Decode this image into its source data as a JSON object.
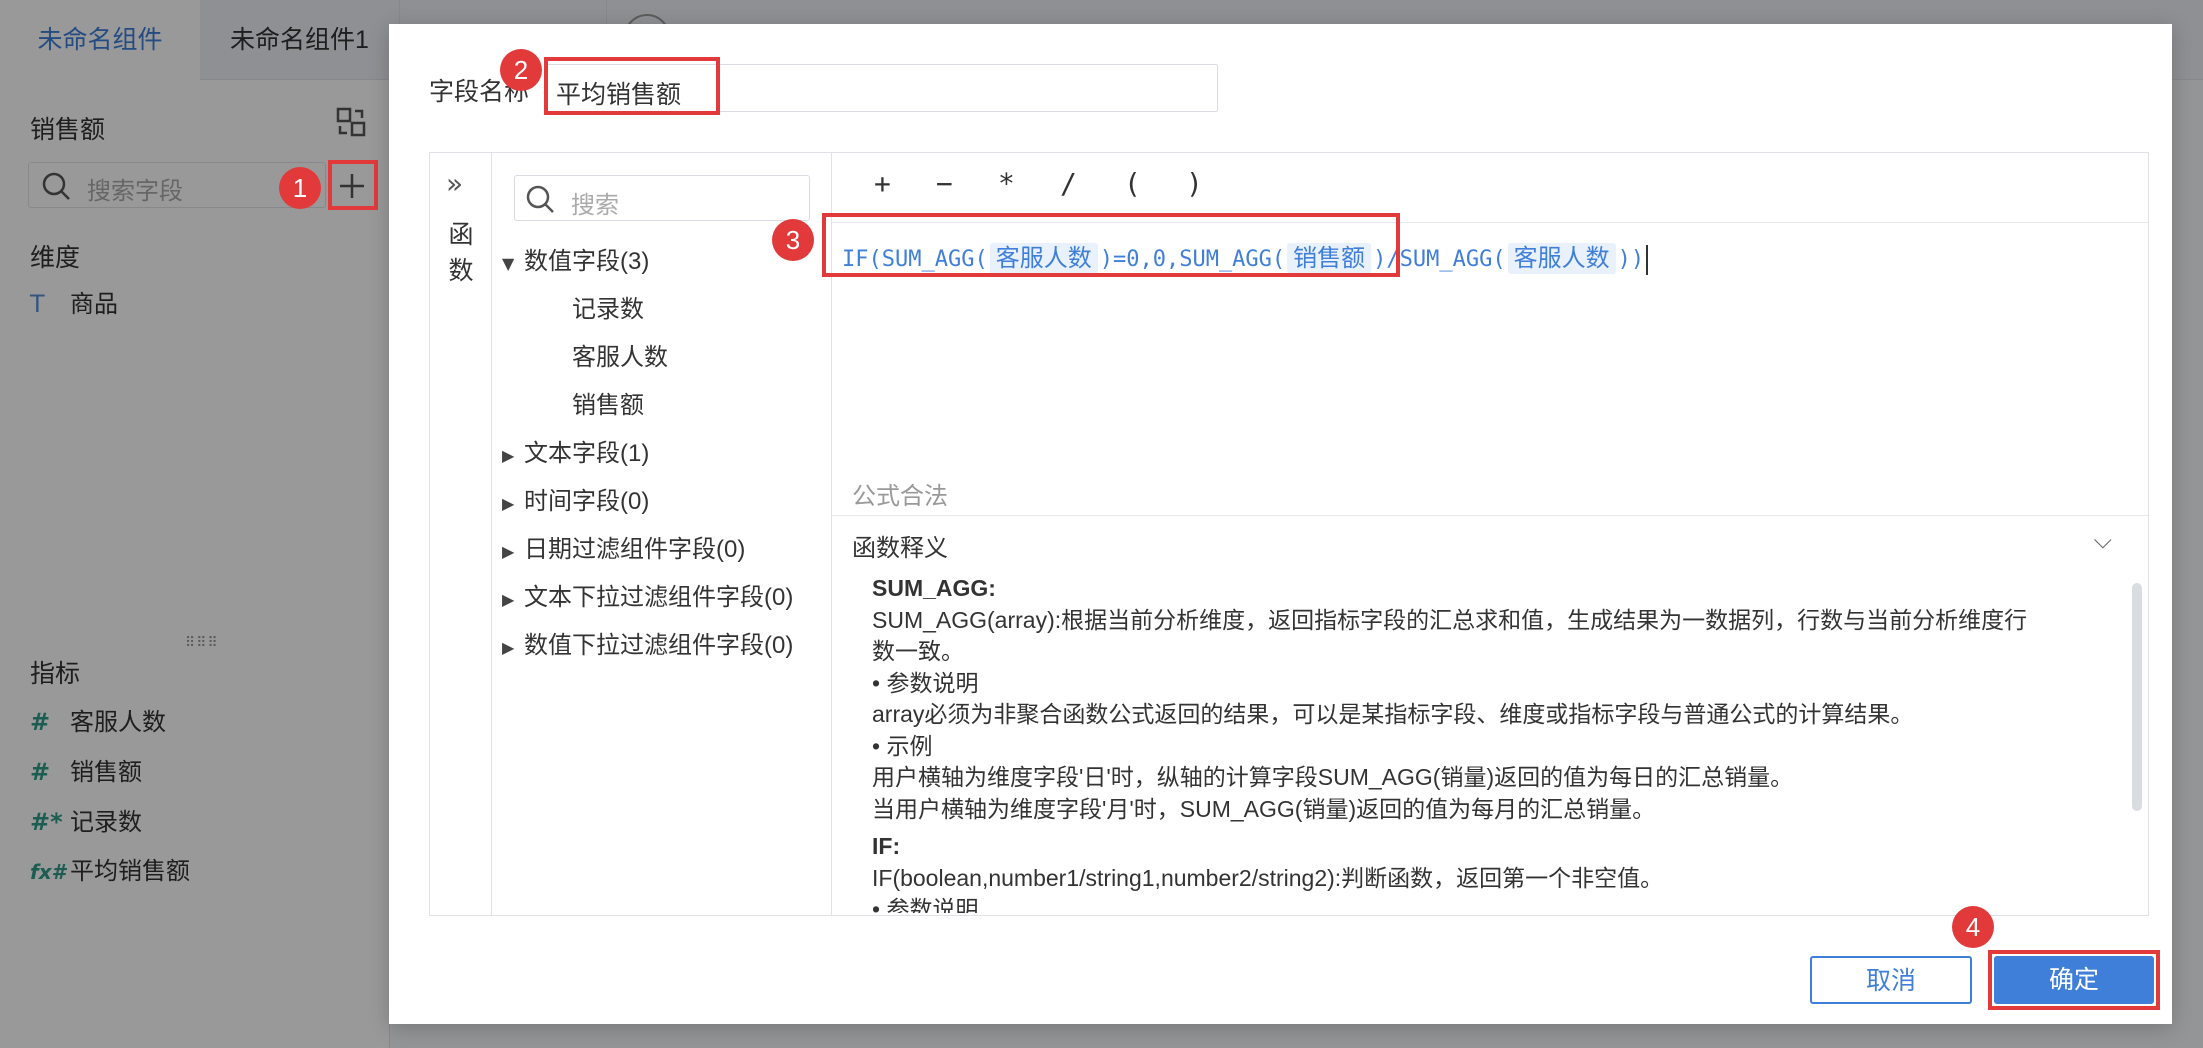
{
  "tabs": {
    "active": "未命名组件",
    "second": "未命名组件1"
  },
  "sidebar": {
    "dataset_title": "销售额",
    "search_placeholder": "搜索字段",
    "dimension_header": "维度",
    "dimensions": [
      {
        "label": "商品",
        "icon": "text-type-icon"
      }
    ],
    "measure_header": "指标",
    "measures": [
      {
        "label": "客服人数",
        "icon": "number-field-icon"
      },
      {
        "label": "销售额",
        "icon": "number-field-icon"
      },
      {
        "label": "记录数",
        "icon": "count-field-icon"
      },
      {
        "label": "平均销售额",
        "icon": "formula-field-icon"
      }
    ]
  },
  "badges": [
    "1",
    "2",
    "3",
    "4"
  ],
  "dialog": {
    "name_label": "字段名称",
    "name_value": "平均销售额",
    "functions_label": "函数",
    "field_search_placeholder": "搜索",
    "tree": [
      {
        "label": "数值字段(3)",
        "expanded": true,
        "children": [
          "记录数",
          "客服人数",
          "销售额"
        ]
      },
      {
        "label": "文本字段(1)",
        "expanded": false
      },
      {
        "label": "时间字段(0)",
        "expanded": false
      },
      {
        "label": "日期过滤组件字段(0)",
        "expanded": false
      },
      {
        "label": "文本下拉过滤组件字段(0)",
        "expanded": false
      },
      {
        "label": "数值下拉过滤组件字段(0)",
        "expanded": false
      }
    ],
    "operators": [
      "+",
      "−",
      "*",
      "/",
      "(",
      ")"
    ],
    "formula": {
      "p1": "IF(",
      "p2": "SUM_AGG(",
      "tok1": "客服人数",
      "p3": ")=0,0,",
      "p4": "SUM_AGG(",
      "tok2": "销售额",
      "p5": ")/",
      "p6": "SUM_AGG(",
      "tok3": "客服人数",
      "p7": "))"
    },
    "validity": "公式合法",
    "explain_title": "函数释义",
    "explain_lines": [
      "SUM_AGG:",
      "SUM_AGG(array):根据当前分析维度，返回指标字段的汇总求和值，生成结果为一数据列，行数与当前分析维度行",
      "数一致。",
      "• 参数说明",
      "array必须为非聚合函数公式返回的结果，可以是某指标字段、维度或指标字段与普通公式的计算结果。",
      "• 示例",
      "用户横轴为维度字段'日'时，纵轴的计算字段SUM_AGG(销量)返回的值为每日的汇总销量。",
      "当用户横轴为维度字段'月'时，SUM_AGG(销量)返回的值为每月的汇总销量。",
      "IF:",
      "IF(boolean,number1/string1,number2/string2):判断函数，返回第一个非空值。",
      "• 参数说明"
    ],
    "cancel": "取消",
    "confirm": "确定"
  },
  "colors": {
    "accent": "#3f7fd9",
    "marker": "#e23a3a"
  }
}
